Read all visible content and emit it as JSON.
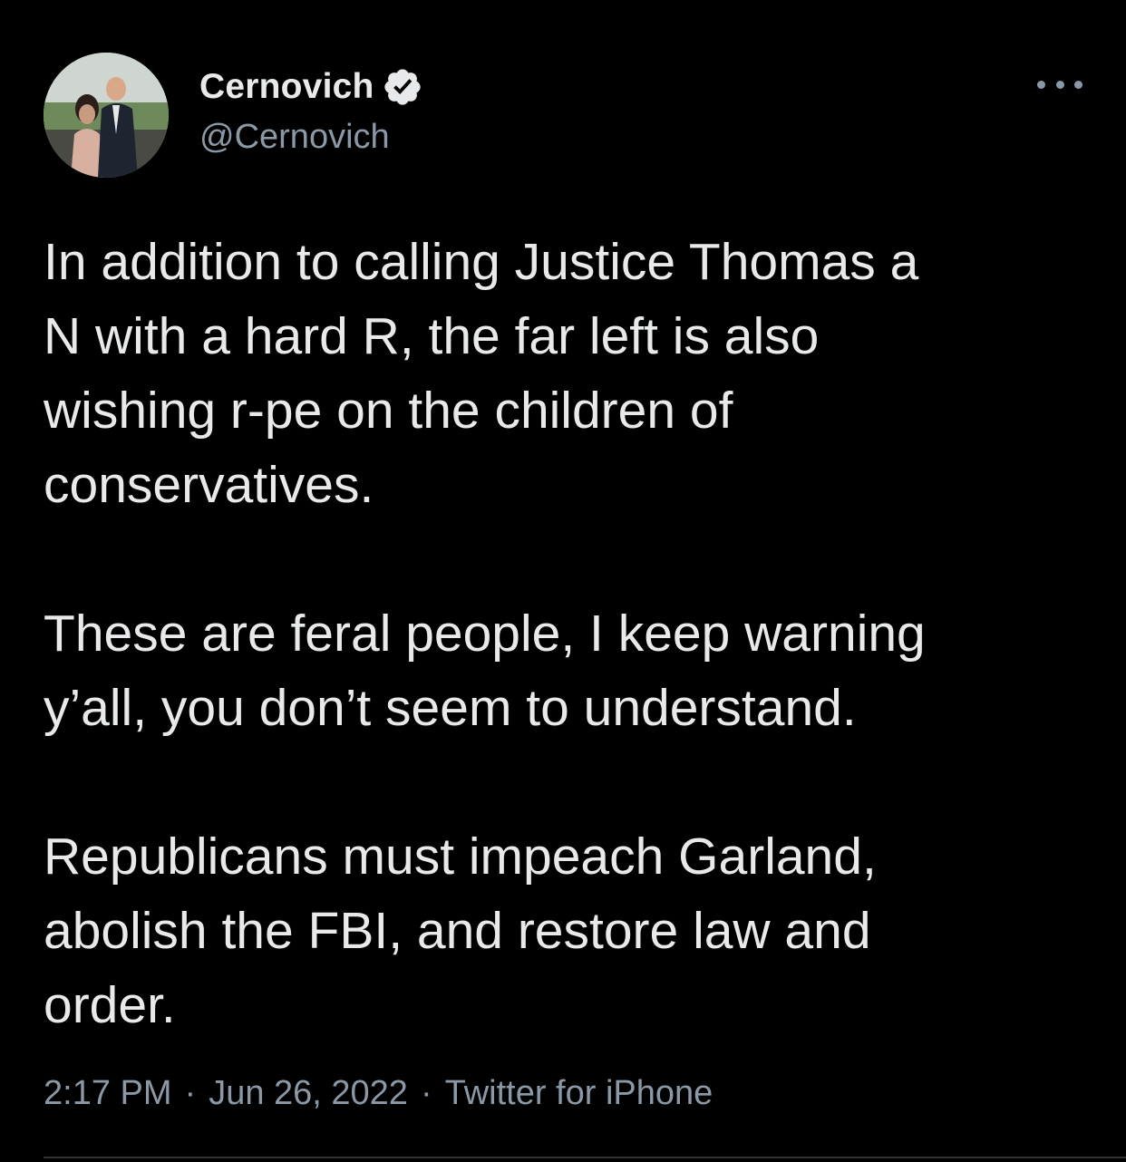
{
  "tweet": {
    "display_name": "Cernovich",
    "handle": "@Cernovich",
    "verified": true,
    "paragraphs": [
      "In addition to calling Justice Thomas a\nN with a hard R, the far left is also\nwishing r-pe on the children of\nconservatives.",
      "These are feral people, I keep warning\ny’all, you don’t seem to understand.",
      "Republicans must impeach Garland,\nabolish the FBI, and restore law and\norder."
    ],
    "time": "2:17 PM",
    "date": "Jun 26, 2022",
    "source": "Twitter for iPhone",
    "separator": "·"
  },
  "icons": {
    "verified": "verified-badge-icon",
    "more": "more-options-icon"
  },
  "colors": {
    "background": "#000000",
    "primary_text": "#e7e9ea",
    "secondary_text": "#8b98a5",
    "divider": "#2f3336"
  }
}
